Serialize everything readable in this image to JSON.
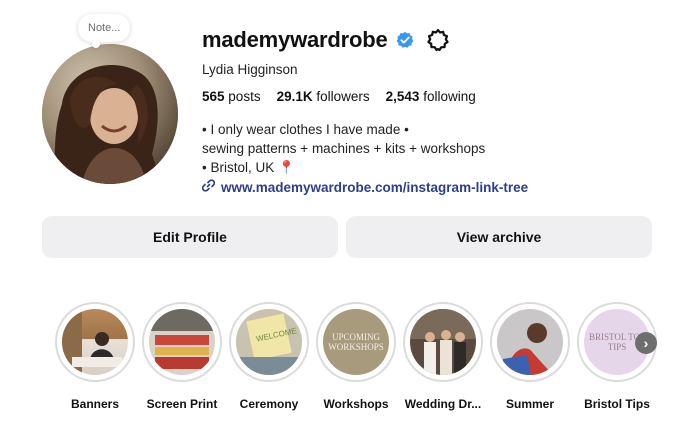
{
  "note": {
    "text": "Note..."
  },
  "profile": {
    "username": "mademywardrobe",
    "full_name": "Lydia Higginson",
    "stats": {
      "posts_count": "565",
      "posts_label": "posts",
      "followers_count": "29.1K",
      "followers_label": "followers",
      "following_count": "2,543",
      "following_label": "following"
    },
    "bio": {
      "line1": "• I only wear clothes I have made •",
      "line2": "sewing patterns + machines + kits + workshops",
      "line3": "• Bristol, UK 📍",
      "link": "www.mademywardrobe.com/instagram-link-tree"
    },
    "verified_color": "#3897f0",
    "link_color": "#2c3e8f"
  },
  "buttons": {
    "edit_profile": "Edit Profile",
    "view_archive": "View archive"
  },
  "highlights": [
    {
      "label": "Banners",
      "icon": "photo"
    },
    {
      "label": "Screen Print",
      "icon": "photo"
    },
    {
      "label": "Ceremony",
      "icon": "photo"
    },
    {
      "label": "Workshops",
      "cover_text": "UPCOMING WORKSHOPS",
      "bg": "#a89b7d"
    },
    {
      "label": "Wedding Dr...",
      "icon": "photo"
    },
    {
      "label": "Summer",
      "icon": "photo"
    },
    {
      "label": "Bristol Tips",
      "cover_text": "BRISTOL TOP TIPS",
      "bg": "#e6d6ea"
    }
  ]
}
